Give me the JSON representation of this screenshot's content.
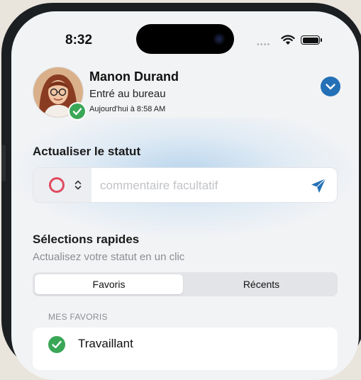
{
  "status_bar": {
    "time": "8:32",
    "icons": [
      "cellular-dots-icon",
      "wifi-icon",
      "battery-icon"
    ]
  },
  "profile": {
    "name": "Manon Durand",
    "status": "Entré au bureau",
    "since": "Aujourd'hui à 8:58 AM",
    "presence_icon": "check-icon",
    "expand_icon": "chevron-down-icon"
  },
  "update_status": {
    "title": "Actualiser le statut",
    "status_icon": "red-ring-icon",
    "comment_placeholder": "commentaire facultatif",
    "comment_value": "",
    "send_icon": "paper-plane-icon"
  },
  "quick": {
    "title": "Sélections rapides",
    "subtitle": "Actualisez votre statut en un clic",
    "tabs": [
      {
        "label": "Favoris",
        "selected": true
      },
      {
        "label": "Récents",
        "selected": false
      }
    ],
    "group_header": "MES FAVORIS",
    "favorites": [
      {
        "label": "Travaillant",
        "icon": "green-check-icon"
      }
    ]
  },
  "colors": {
    "accent": "#2370b6",
    "success": "#3aa757",
    "away_ring": "#e04a5f",
    "background": "#f2f3f5"
  }
}
